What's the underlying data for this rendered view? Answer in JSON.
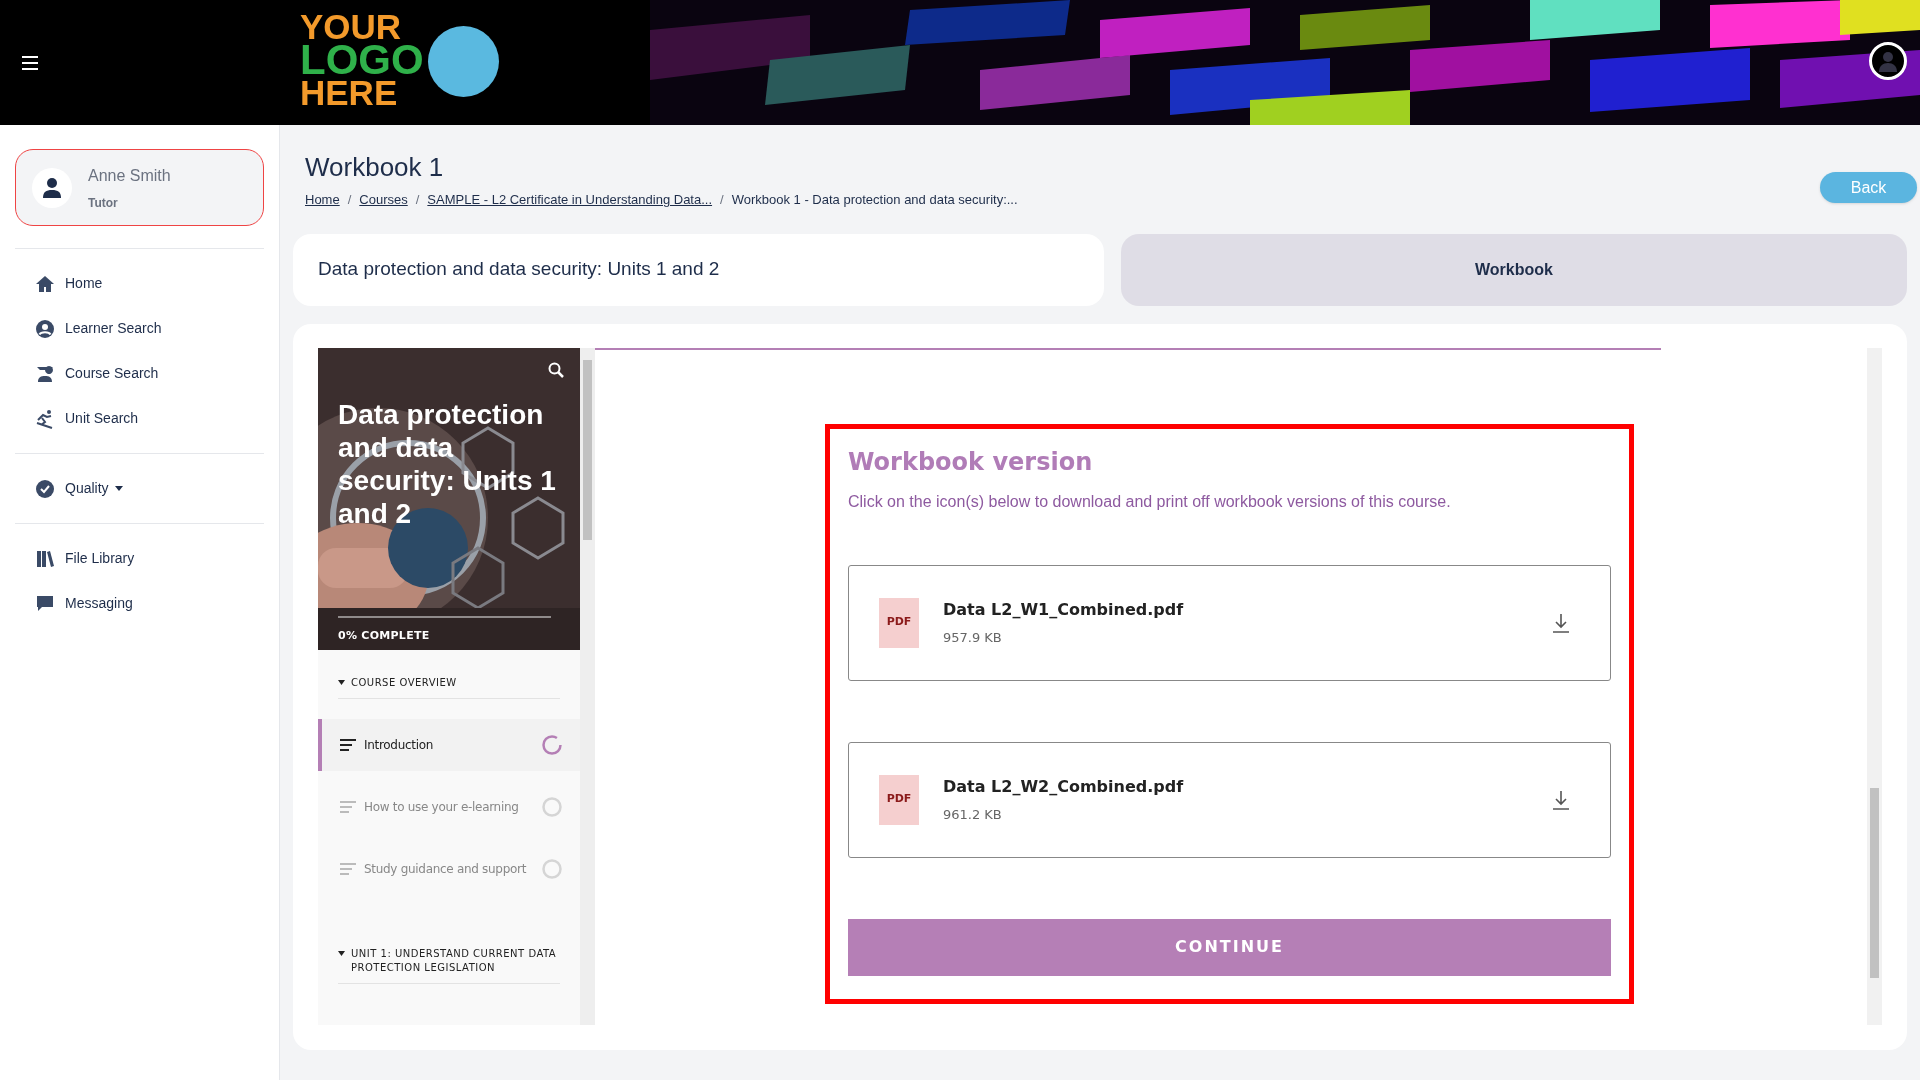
{
  "header": {
    "logo": [
      "YOUR",
      "LOGO",
      "HERE"
    ]
  },
  "user": {
    "name": "Anne Smith",
    "role": "Tutor"
  },
  "nav_groups": [
    [
      {
        "label": "Home"
      },
      {
        "label": "Learner Search"
      },
      {
        "label": "Course Search"
      },
      {
        "label": "Unit Search"
      }
    ],
    [
      {
        "label": "Quality",
        "dropdown": true
      }
    ],
    [
      {
        "label": "File Library"
      },
      {
        "label": "Messaging"
      }
    ]
  ],
  "page": {
    "title": "Workbook 1",
    "back_button": "Back",
    "breadcrumb": [
      {
        "label": "Home",
        "link": true
      },
      {
        "separator": "/",
        "label": "Courses",
        "link": true
      },
      {
        "separator": "/",
        "label": "SAMPLE - L2 Certificate in Understanding Data...",
        "link": true
      },
      {
        "separator": "/",
        "label": "Workbook 1 - Data protection and data security:...",
        "link": false
      }
    ]
  },
  "tabs": [
    {
      "label": "Data protection and data security: Units 1 and 2",
      "selected": true
    },
    {
      "label": "Workbook",
      "selected": false
    }
  ],
  "course_nav": {
    "cover_title": "Data protection and data security: Units 1 and 2",
    "progress_label": "0% COMPLETE",
    "sections": [
      {
        "heading": "COURSE OVERVIEW",
        "expanded": true,
        "lessons": [
          {
            "title": "Introduction",
            "selected": true,
            "started": true
          },
          {
            "title": "How to use your e-learning",
            "selected": false,
            "started": false
          },
          {
            "title": "Study guidance and support",
            "selected": false,
            "started": false
          }
        ]
      },
      {
        "heading": "UNIT 1: UNDERSTAND CURRENT DATA PROTECTION LEGISLATION",
        "expanded": true
      }
    ]
  },
  "content": {
    "heading": "Workbook version",
    "description": "Click on the icon(s) below to download and print off workbook versions of this course.",
    "files": [
      {
        "badge": "PDF",
        "name": "Data L2_W1_Combined.pdf",
        "size": "957.9 KB"
      },
      {
        "badge": "PDF",
        "name": "Data L2_W2_Combined.pdf",
        "size": "961.2 KB"
      }
    ],
    "continue_button": "CONTINUE"
  }
}
